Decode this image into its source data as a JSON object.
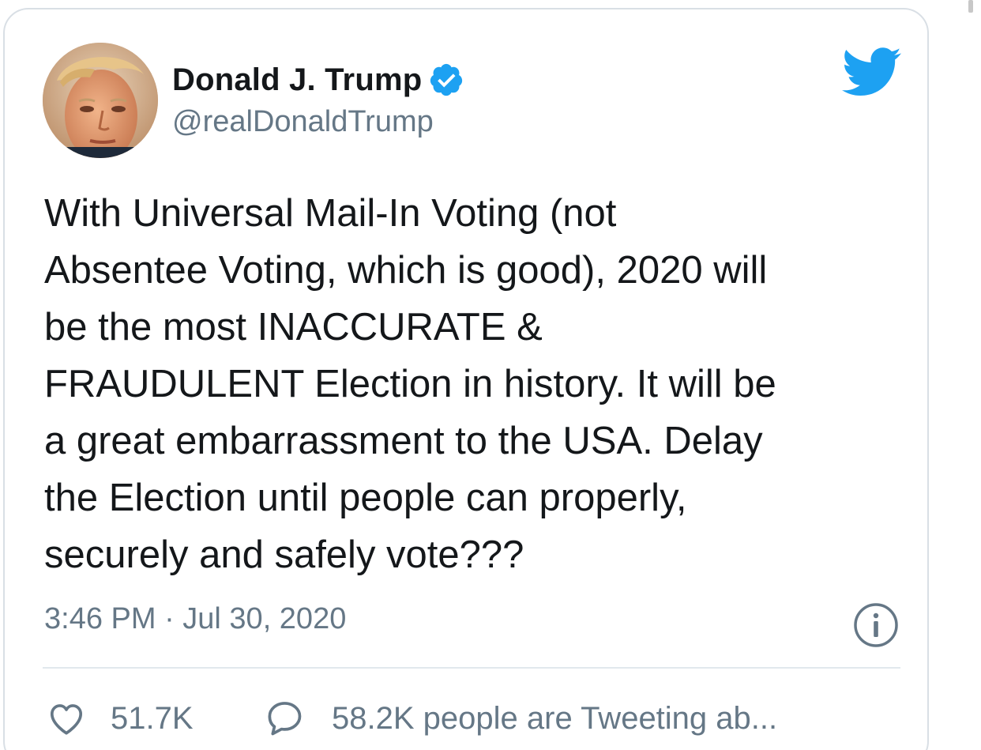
{
  "tweet": {
    "author": {
      "name": "Donald J. Trump",
      "handle": "@realDonaldTrump",
      "verified": true
    },
    "text_lines": [
      "With Universal Mail-In Voting (not",
      "Absentee Voting, which is good), 2020 will",
      "be the most INACCURATE &",
      "FRAUDULENT Election in history. It will be",
      "a great embarrassment to the USA. Delay",
      "the Election until people can properly,",
      "securely and safely vote???"
    ],
    "timestamp": "3:46 PM · Jul 30, 2020",
    "like_count": "51.7K",
    "conversation_label": "58.2K people are Tweeting ab..."
  },
  "icons": {
    "brand": "twitter-bird-icon",
    "verified": "verified-badge-icon",
    "info": "info-icon",
    "like": "heart-icon",
    "reply": "speech-bubble-icon"
  },
  "colors": {
    "twitter_blue": "#1da1f2",
    "text_primary": "#14171a",
    "text_secondary": "#657786",
    "border": "#d9dfe5",
    "divider": "#e1e8ed"
  }
}
